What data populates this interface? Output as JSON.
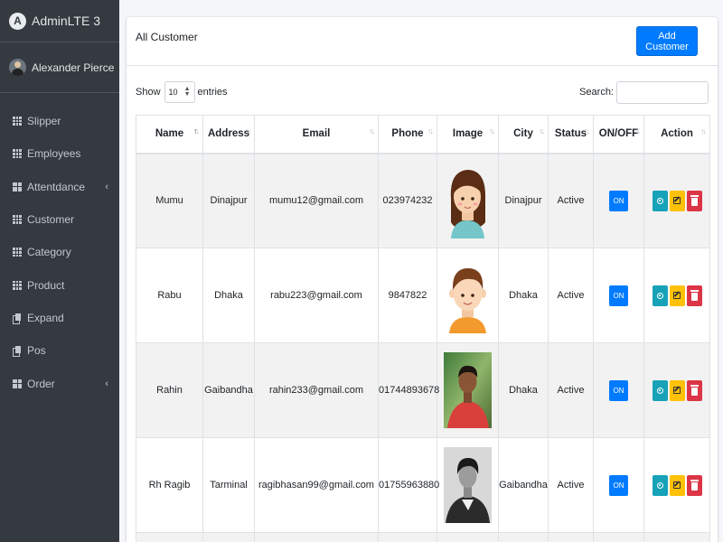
{
  "brand": {
    "name": "AdminLTE 3",
    "logo_letter": "A"
  },
  "user": {
    "name": "Alexander Pierce"
  },
  "nav": [
    {
      "label": "Slipper",
      "icon": "table-icon",
      "has_chevron": false
    },
    {
      "label": "Employees",
      "icon": "table-icon",
      "has_chevron": false
    },
    {
      "label": "Attentdance",
      "icon": "columns-icon",
      "has_chevron": true
    },
    {
      "label": "Customer",
      "icon": "table-icon",
      "has_chevron": false
    },
    {
      "label": "Category",
      "icon": "table-icon",
      "has_chevron": false
    },
    {
      "label": "Product",
      "icon": "table-icon",
      "has_chevron": false
    },
    {
      "label": "Expand",
      "icon": "copy-icon",
      "has_chevron": false
    },
    {
      "label": "Pos",
      "icon": "copy-icon",
      "has_chevron": false
    },
    {
      "label": "Order",
      "icon": "columns-icon",
      "has_chevron": true
    }
  ],
  "card": {
    "title": "All Customer",
    "add_button": "Add Customer"
  },
  "controls": {
    "show_label": "Show",
    "entries_value": "10",
    "entries_label": "entries",
    "search_label": "Search:",
    "search_value": ""
  },
  "table": {
    "columns": [
      "Name",
      "Address",
      "Email",
      "Phone",
      "Image",
      "City",
      "Status",
      "ON/OFF",
      "Action"
    ],
    "rows": [
      {
        "name": "Mumu",
        "address": "Dinajpur",
        "email": "mumu12@gmail.com",
        "phone": "023974232",
        "image": "cartoon-girl",
        "city": "Dinajpur",
        "status": "Active",
        "toggle": "ON"
      },
      {
        "name": "Rabu",
        "address": "Dhaka",
        "email": "rabu223@gmail.com",
        "phone": "9847822",
        "image": "cartoon-boy",
        "city": "Dhaka",
        "status": "Active",
        "toggle": "ON"
      },
      {
        "name": "Rahin",
        "address": "Gaibandha",
        "email": "rahin233@gmail.com",
        "phone": "01744893678",
        "image": "photo-red-shirt",
        "city": "Dhaka",
        "status": "Active",
        "toggle": "ON"
      },
      {
        "name": "Rh Ragib",
        "address": "Tarminal",
        "email": "ragibhasan99@gmail.com",
        "phone": "01755963880",
        "image": "photo-bw",
        "city": "Gaibandha",
        "status": "Active",
        "toggle": "ON"
      }
    ]
  },
  "colors": {
    "sidebar_bg": "#343a40",
    "primary": "#007bff",
    "info": "#17a2b8",
    "warning": "#ffc107",
    "danger": "#dc3545"
  }
}
